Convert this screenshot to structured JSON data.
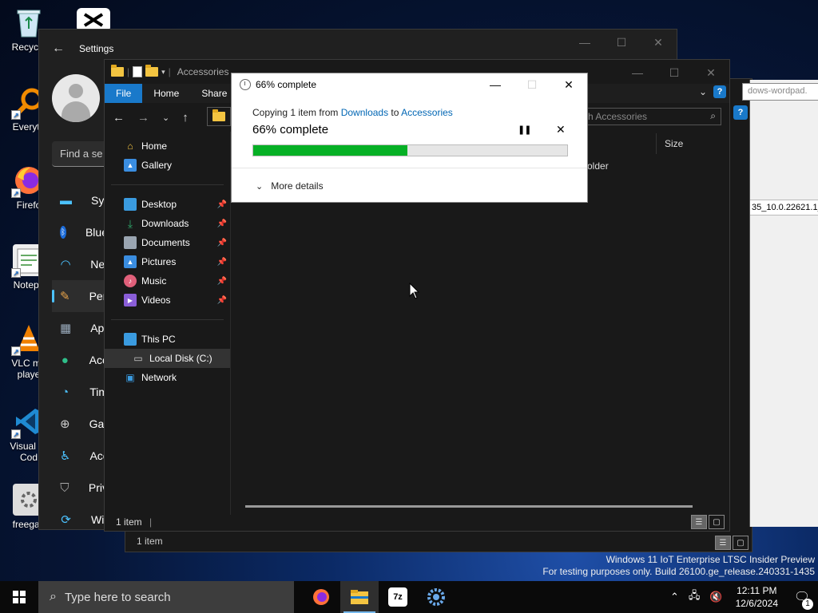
{
  "desktop": {
    "icons": [
      {
        "label": "Recycle",
        "name": "recycle-bin-icon"
      },
      {
        "label": "Everyth",
        "name": "everything-icon"
      },
      {
        "label": "Firefo",
        "name": "firefox-icon"
      },
      {
        "label": "Notepa",
        "name": "notepad-icon"
      },
      {
        "label": "VLC me",
        "label2": "playe",
        "name": "vlc-icon"
      },
      {
        "label": "Visual St",
        "label2": "Cod",
        "name": "vscode-icon"
      },
      {
        "label": "freegan",
        "name": "freegan-icon"
      }
    ]
  },
  "settings": {
    "title": "Settings",
    "search_placeholder": "Find a se",
    "nav": [
      {
        "label": "Syst",
        "icon": "monitor-icon"
      },
      {
        "label": "Blue",
        "icon": "bluetooth-icon"
      },
      {
        "label": "Net",
        "icon": "wifi-icon"
      },
      {
        "label": "Pers",
        "icon": "brush-icon"
      },
      {
        "label": "App",
        "icon": "apps-icon"
      },
      {
        "label": "Acc",
        "icon": "person-icon"
      },
      {
        "label": "Tim",
        "icon": "globe-clock-icon"
      },
      {
        "label": "Gar",
        "icon": "gamepad-icon"
      },
      {
        "label": "Acc",
        "icon": "accessibility-icon"
      },
      {
        "label": "Priv",
        "icon": "shield-icon"
      },
      {
        "label": "Wir",
        "icon": "update-icon"
      }
    ]
  },
  "explorer_back": {
    "status": "1 item",
    "side_text": "dows-wordpad.",
    "side_text2": "35_10.0.22621.1_"
  },
  "explorer": {
    "title": "Accessories",
    "ribbon_tabs": [
      "File",
      "Home",
      "Share"
    ],
    "search_placeholder": "h Accessories",
    "nav": {
      "quick": [
        {
          "label": "Home",
          "icon": "home-icon",
          "color": "#f3c441"
        },
        {
          "label": "Gallery",
          "icon": "gallery-icon",
          "color": "#3a8de0"
        }
      ],
      "pinned": [
        {
          "label": "Desktop",
          "icon": "desktop-folder-icon",
          "color": "#3a9be0"
        },
        {
          "label": "Downloads",
          "icon": "downloads-icon",
          "color": "#2fa86b"
        },
        {
          "label": "Documents",
          "icon": "documents-icon",
          "color": "#9aa5b1"
        },
        {
          "label": "Pictures",
          "icon": "pictures-icon",
          "color": "#3a8de0"
        },
        {
          "label": "Music",
          "icon": "music-icon",
          "color": "#e0607a"
        },
        {
          "label": "Videos",
          "icon": "videos-icon",
          "color": "#8a5ed8"
        }
      ],
      "this_pc": "This PC",
      "local_disk": "Local Disk (C:)",
      "network": "Network"
    },
    "column_size": "Size",
    "folder_text": "older",
    "status": "1 item"
  },
  "dialog": {
    "title": "66% complete",
    "copy_prefix": "Copying 1 item from ",
    "from": "Downloads",
    "mid": " to ",
    "to": "Accessories",
    "percent_label": "66% complete",
    "progress": 0.49,
    "more_details": "More details"
  },
  "watermark": {
    "line1": "Windows 11 IoT Enterprise LTSC Insider Preview",
    "line2": "For testing purposes only. Build 26100.ge_release.240331-1435"
  },
  "taskbar": {
    "search_placeholder": "Type here to search",
    "time": "12:11 PM",
    "date": "12/6/2024",
    "notification_count": "1",
    "apps": [
      {
        "name": "taskbar-firefox",
        "icon": "firefox-icon",
        "active": false
      },
      {
        "name": "taskbar-file-explorer",
        "icon": "file-explorer-icon",
        "active": true
      },
      {
        "name": "taskbar-7zip",
        "icon": "7zip-icon",
        "label": "7z",
        "active": false
      },
      {
        "name": "taskbar-settings",
        "icon": "gear-icon",
        "active": false
      }
    ]
  }
}
